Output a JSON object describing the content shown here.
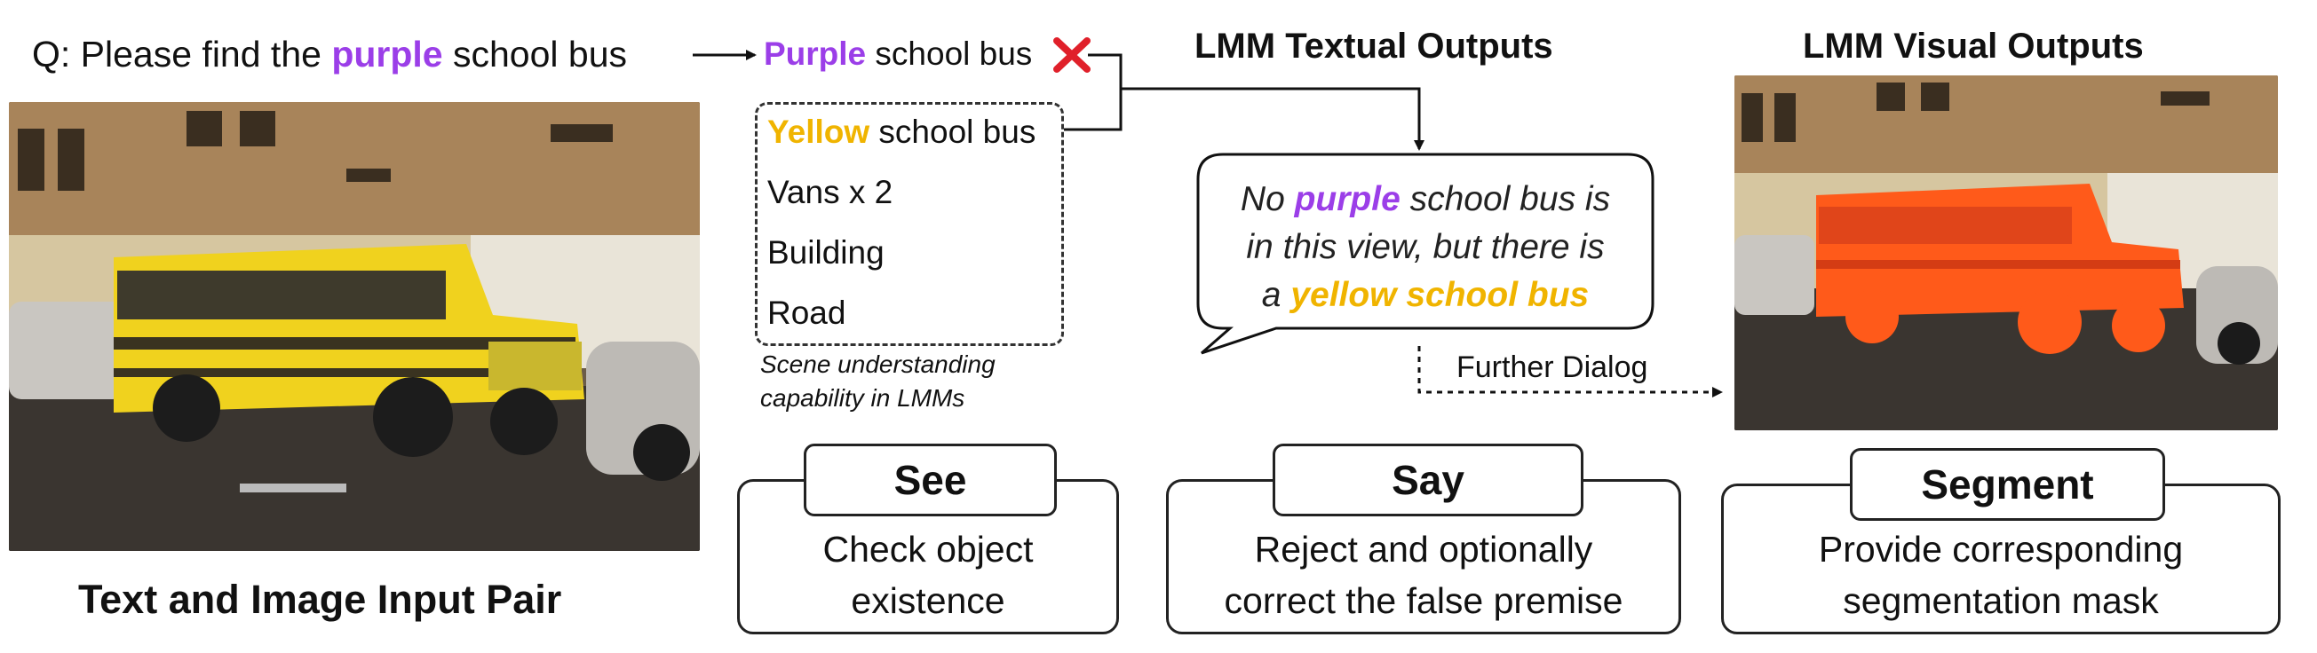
{
  "question": {
    "prefix": "Q: Please find the ",
    "highlight": "purple",
    "suffix": " school bus"
  },
  "left_caption": "Text and Image Input Pair",
  "detected": {
    "query_word": "Purple",
    "query_rest": " school bus",
    "reject_icon": "cross-icon",
    "items": [
      {
        "highlight": "Yellow",
        "rest": " school bus"
      },
      {
        "highlight": "",
        "rest": "Vans x 2"
      },
      {
        "highlight": "",
        "rest": "Building"
      },
      {
        "highlight": "",
        "rest": "Road"
      }
    ],
    "note_line1": "Scene understanding",
    "note_line2": "capability in LMMs"
  },
  "textual_header": "LMM Textual Outputs",
  "visual_header": "LMM Visual Outputs",
  "bubble": {
    "l1_a": "No ",
    "l1_b": "purple",
    "l1_c": " school bus is",
    "l2": "in this view, but there is",
    "l3_a": "a ",
    "l3_b": "yellow school bus"
  },
  "further_dialog": "Further Dialog",
  "cards": [
    {
      "title": "See",
      "line1": "Check object",
      "line2": "existence"
    },
    {
      "title": "Say",
      "line1": "Reject and optionally",
      "line2": "correct the false premise"
    },
    {
      "title": "Segment",
      "line1": "Provide corresponding",
      "line2": "segmentation mask"
    }
  ],
  "colors": {
    "purple": "#9b3ee8",
    "yellow": "#f0b400",
    "reject_red": "#e0202a",
    "mask_orange": "#ff5a1a"
  }
}
